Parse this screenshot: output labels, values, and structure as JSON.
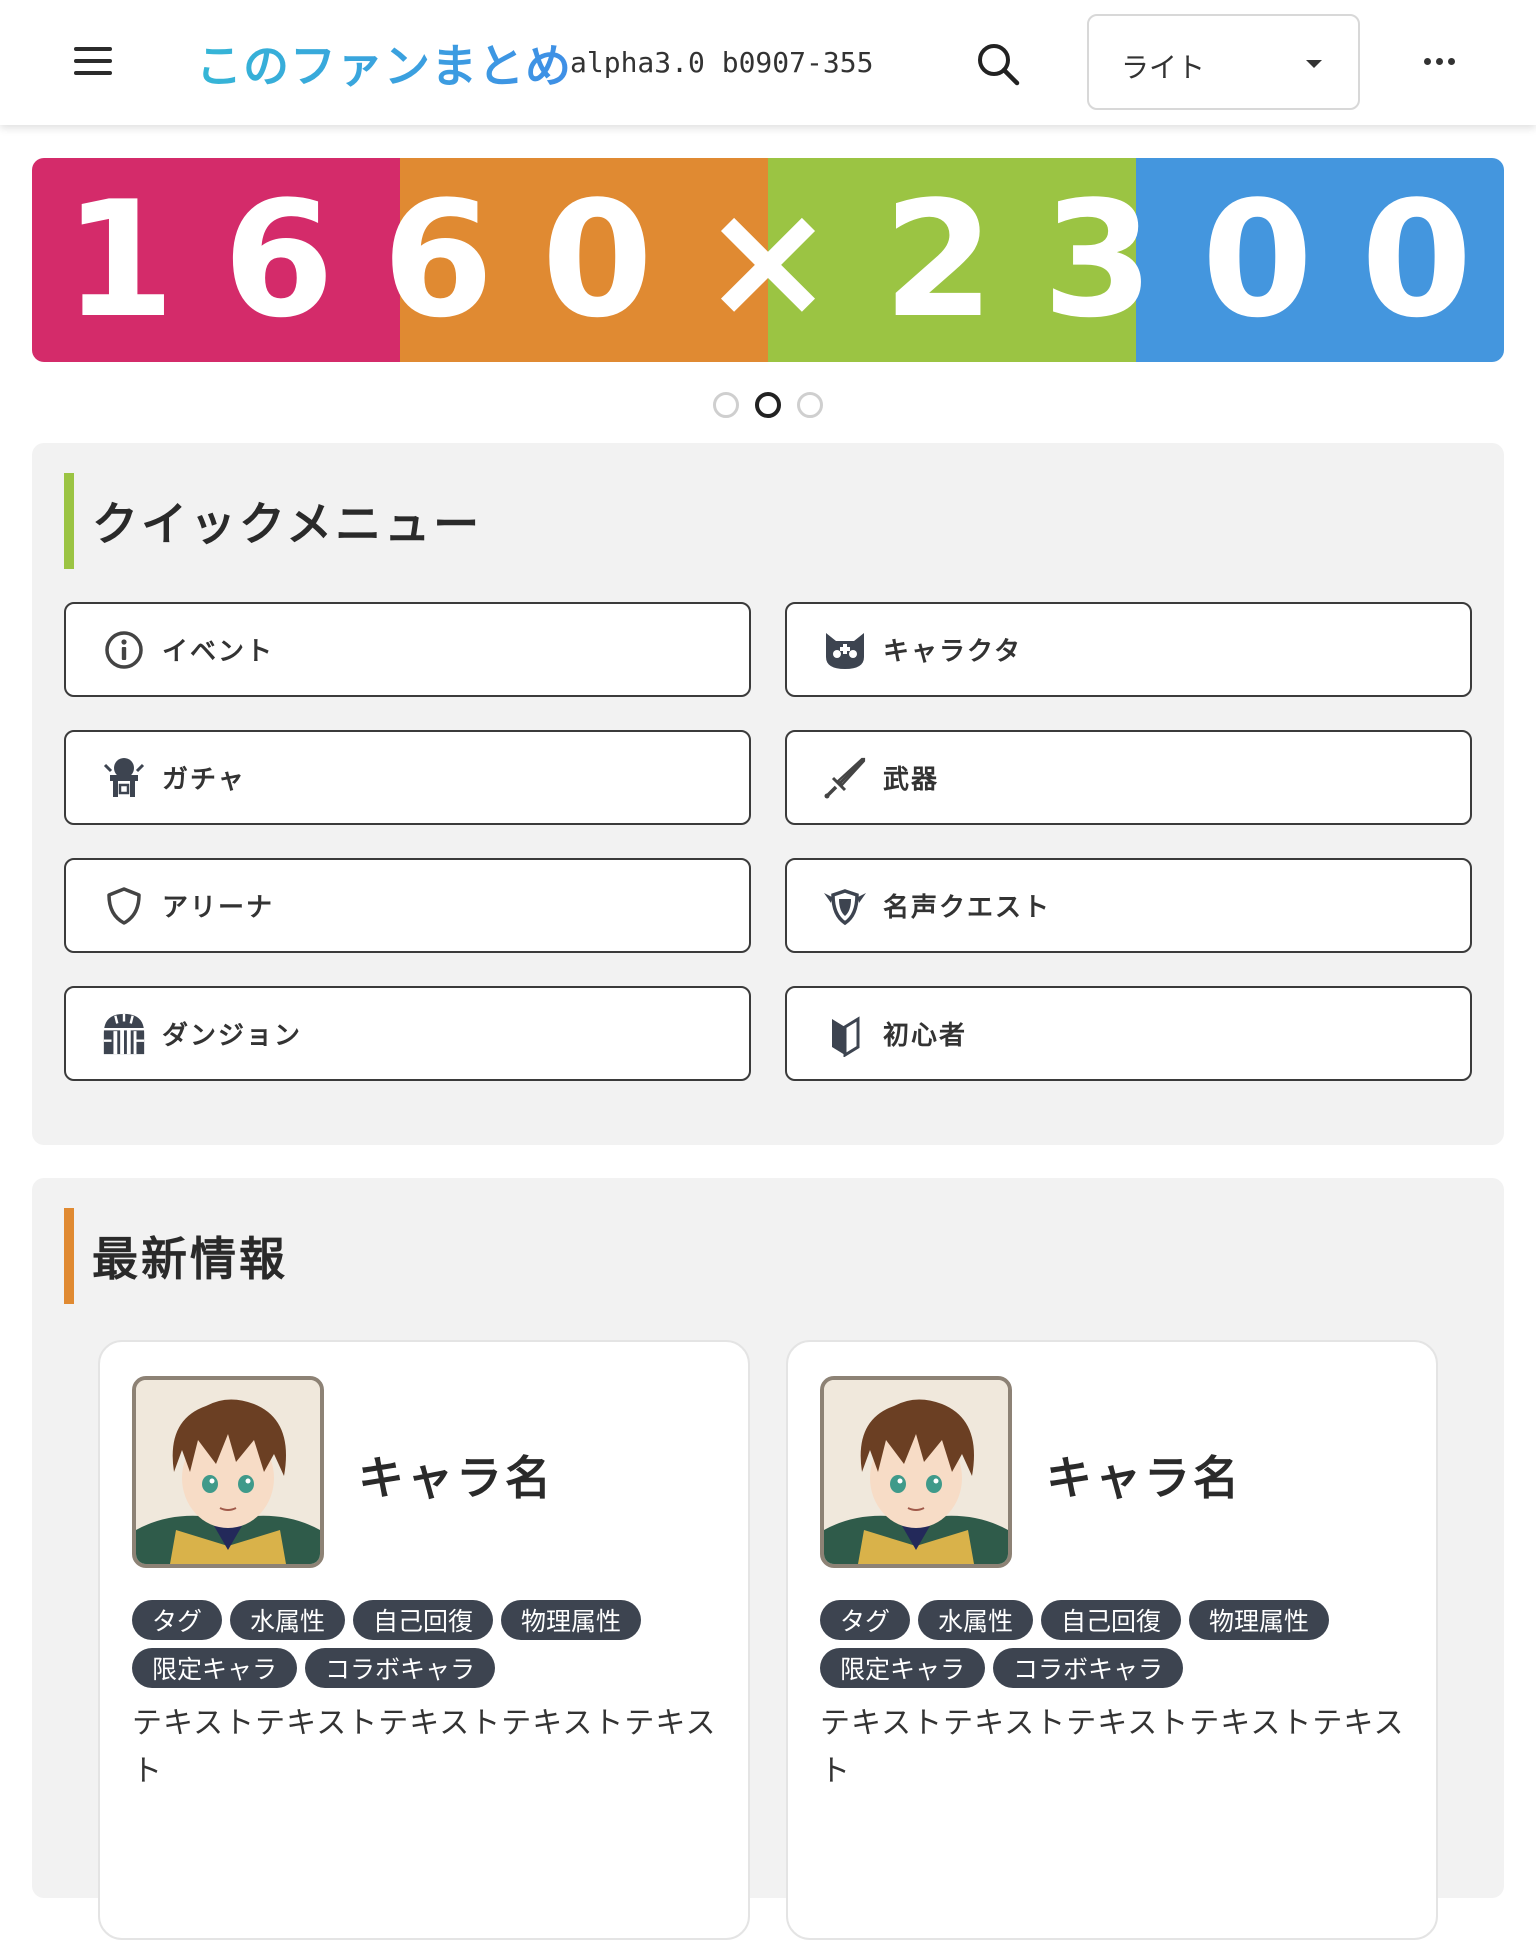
{
  "header": {
    "title": "このファンまとめ",
    "version": "alpha3.0 b0907-355",
    "theme_value": "ライト"
  },
  "banner": {
    "text": "1660×2300",
    "colors": [
      "#d42b6a",
      "#e08a32",
      "#9bc443",
      "#4496de"
    ],
    "slide_count": 3,
    "active_slide": 2
  },
  "quick_menu": {
    "title": "クイックメニュー",
    "accent": "#9bc443",
    "items": [
      {
        "label": "イベント",
        "icon": "info-icon"
      },
      {
        "label": "キャラクタ",
        "icon": "cat-face-icon"
      },
      {
        "label": "ガチャ",
        "icon": "gacha-machine-icon"
      },
      {
        "label": "武器",
        "icon": "sword-icon"
      },
      {
        "label": "アリーナ",
        "icon": "shield-icon"
      },
      {
        "label": "名声クエスト",
        "icon": "winged-shield-icon"
      },
      {
        "label": "ダンジョン",
        "icon": "dungeon-gate-icon"
      },
      {
        "label": "初心者",
        "icon": "beginner-mark-icon"
      }
    ]
  },
  "news": {
    "title": "最新情報",
    "accent": "#e08a32",
    "cards": [
      {
        "name": "キャラ名",
        "tags": [
          "タグ",
          "水属性",
          "自己回復",
          "物理属性",
          "限定キャラ",
          "コラボキャラ"
        ],
        "text": "テキストテキストテキストテキストテキスト"
      },
      {
        "name": "キャラ名",
        "tags": [
          "タグ",
          "水属性",
          "自己回復",
          "物理属性",
          "限定キャラ",
          "コラボキャラ"
        ],
        "text": "テキストテキストテキストテキストテキスト"
      }
    ]
  }
}
